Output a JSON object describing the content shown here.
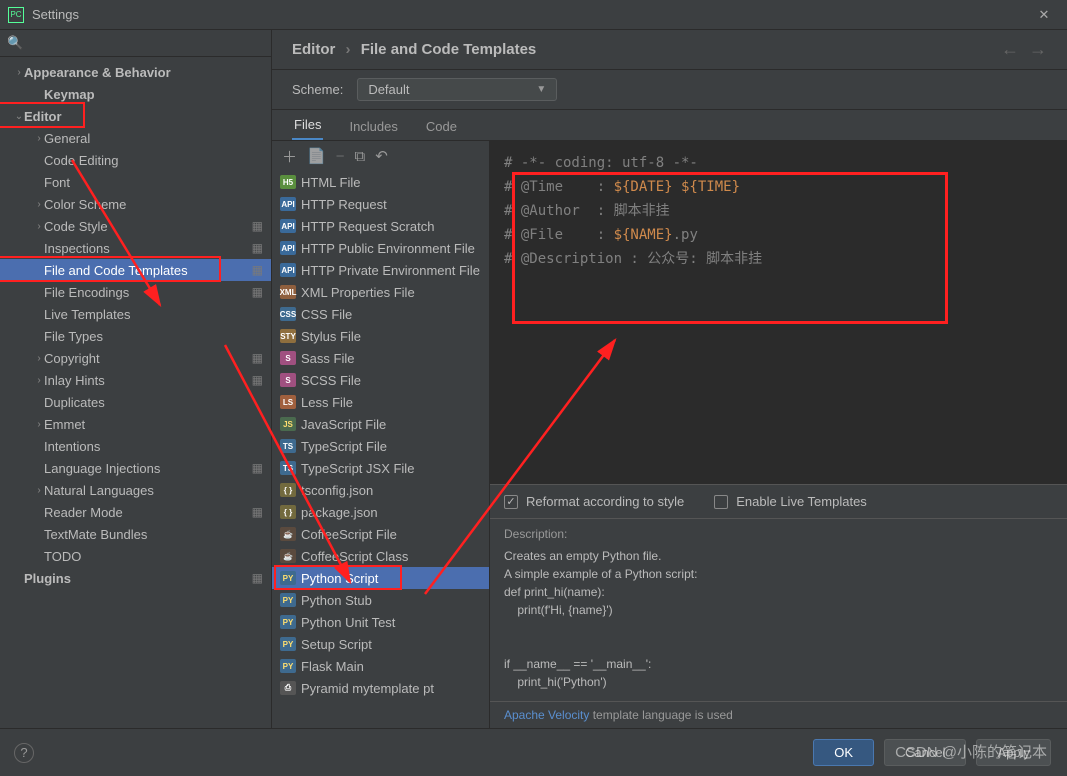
{
  "title": "Settings",
  "logo_text": "PC",
  "breadcrumb": {
    "part1": "Editor",
    "sep": "›",
    "part2": "File and Code Templates"
  },
  "scheme": {
    "label": "Scheme:",
    "value": "Default"
  },
  "tabs": [
    {
      "label": "Files",
      "active": true
    },
    {
      "label": "Includes",
      "active": false
    },
    {
      "label": "Code",
      "active": false
    }
  ],
  "sidebar_tree": [
    {
      "label": "Appearance & Behavior",
      "level": 0,
      "chev": "›",
      "bold": true
    },
    {
      "label": "Keymap",
      "level": 1,
      "bold": true
    },
    {
      "label": "Editor",
      "level": 0,
      "chev": "⌄",
      "bold": true,
      "redbox": true
    },
    {
      "label": "General",
      "level": 1,
      "chev": "›"
    },
    {
      "label": "Code Editing",
      "level": 1
    },
    {
      "label": "Font",
      "level": 1
    },
    {
      "label": "Color Scheme",
      "level": 1,
      "chev": "›"
    },
    {
      "label": "Code Style",
      "level": 1,
      "chev": "›",
      "gear": true
    },
    {
      "label": "Inspections",
      "level": 1,
      "gear": true
    },
    {
      "label": "File and Code Templates",
      "level": 1,
      "gear": true,
      "selected": true,
      "redbox": true
    },
    {
      "label": "File Encodings",
      "level": 1,
      "gear": true
    },
    {
      "label": "Live Templates",
      "level": 1
    },
    {
      "label": "File Types",
      "level": 1
    },
    {
      "label": "Copyright",
      "level": 1,
      "chev": "›",
      "gear": true
    },
    {
      "label": "Inlay Hints",
      "level": 1,
      "chev": "›",
      "gear": true
    },
    {
      "label": "Duplicates",
      "level": 1
    },
    {
      "label": "Emmet",
      "level": 1,
      "chev": "›"
    },
    {
      "label": "Intentions",
      "level": 1
    },
    {
      "label": "Language Injections",
      "level": 1,
      "gear": true
    },
    {
      "label": "Natural Languages",
      "level": 1,
      "chev": "›"
    },
    {
      "label": "Reader Mode",
      "level": 1,
      "gear": true
    },
    {
      "label": "TextMate Bundles",
      "level": 1
    },
    {
      "label": "TODO",
      "level": 1
    },
    {
      "label": "Plugins",
      "level": 0,
      "bold": true,
      "gear": true
    }
  ],
  "file_list": [
    {
      "label": "HTML File",
      "ic": "ic-html",
      "t": "H5"
    },
    {
      "label": "HTTP Request",
      "ic": "ic-http",
      "t": "API"
    },
    {
      "label": "HTTP Request Scratch",
      "ic": "ic-http",
      "t": "API"
    },
    {
      "label": "HTTP Public Environment File",
      "ic": "ic-http",
      "t": "API"
    },
    {
      "label": "HTTP Private Environment File",
      "ic": "ic-http",
      "t": "API"
    },
    {
      "label": "XML Properties File",
      "ic": "ic-xml",
      "t": "XML"
    },
    {
      "label": "CSS File",
      "ic": "ic-css",
      "t": "CSS"
    },
    {
      "label": "Stylus File",
      "ic": "ic-styl",
      "t": "STY"
    },
    {
      "label": "Sass File",
      "ic": "ic-sass",
      "t": "S"
    },
    {
      "label": "SCSS File",
      "ic": "ic-sass",
      "t": "S"
    },
    {
      "label": "Less File",
      "ic": "ic-less",
      "t": "LS"
    },
    {
      "label": "JavaScript File",
      "ic": "ic-js",
      "t": "JS"
    },
    {
      "label": "TypeScript File",
      "ic": "ic-ts",
      "t": "TS"
    },
    {
      "label": "TypeScript JSX File",
      "ic": "ic-ts",
      "t": "TS"
    },
    {
      "label": "tsconfig.json",
      "ic": "ic-json",
      "t": "{ }"
    },
    {
      "label": "package.json",
      "ic": "ic-json",
      "t": "{ }"
    },
    {
      "label": "CoffeeScript File",
      "ic": "ic-coffee",
      "t": "☕"
    },
    {
      "label": "CoffeeScript Class",
      "ic": "ic-coffee",
      "t": "☕"
    },
    {
      "label": "Python Script",
      "ic": "ic-py",
      "t": "PY",
      "selected": true,
      "redbox": true
    },
    {
      "label": "Python Stub",
      "ic": "ic-py",
      "t": "PY"
    },
    {
      "label": "Python Unit Test",
      "ic": "ic-py",
      "t": "PY"
    },
    {
      "label": "Setup Script",
      "ic": "ic-py",
      "t": "PY"
    },
    {
      "label": "Flask Main",
      "ic": "ic-py",
      "t": "PY"
    },
    {
      "label": "Pyramid mytemplate pt",
      "ic": "ic-txt",
      "t": "⎙"
    }
  ],
  "code_lines": [
    {
      "pre": "# -*- coding: utf-8 -*-",
      "kw": "",
      "post": ""
    },
    {
      "pre": "# @Time    : ",
      "kw": "${DATE} ${TIME}",
      "post": ""
    },
    {
      "pre": "# @Author  : 脚本非挂",
      "kw": "",
      "post": ""
    },
    {
      "pre": "# @File    : ",
      "kw": "${NAME}",
      "post": ".py"
    },
    {
      "pre": "# @Description : 公众号: 脚本非挂",
      "kw": "",
      "post": ""
    }
  ],
  "options": {
    "reformat": {
      "label": "Reformat according to style",
      "checked": true
    },
    "live_templates": {
      "label": "Enable Live Templates",
      "checked": false
    }
  },
  "description": {
    "title": "Description:",
    "body": "Creates an empty Python file.\nA simple example of a Python script:\ndef print_hi(name):\n    print(f'Hi, {name}')\n\n\nif __name__ == '__main__':\n    print_hi('Python')"
  },
  "velocity": {
    "link_text": "Apache Velocity",
    "rest": " template language is used"
  },
  "buttons": {
    "ok": "OK",
    "cancel": "Cancel",
    "apply": "Apply"
  },
  "watermark": "CSDN @小陈的笔记本"
}
